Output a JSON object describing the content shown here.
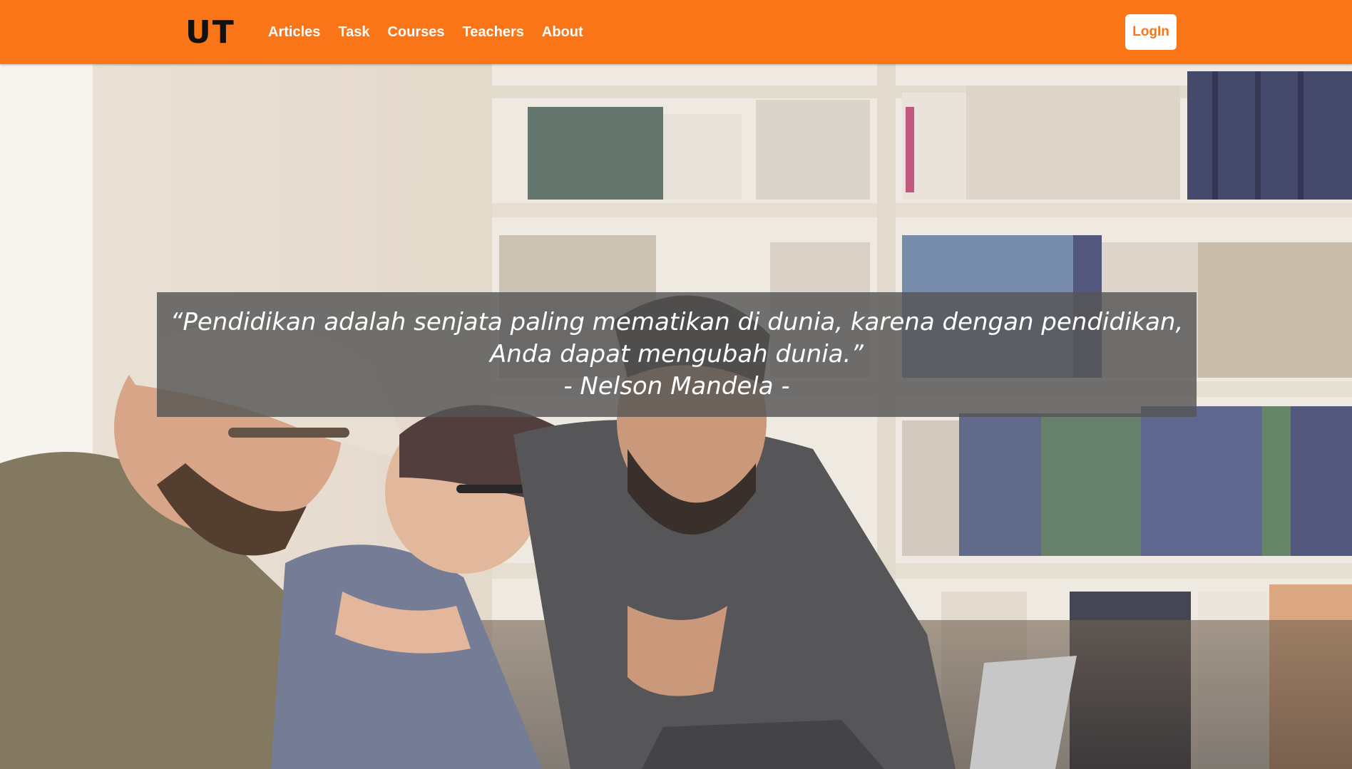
{
  "brand": {
    "logo_text": "UT"
  },
  "nav": {
    "links": [
      "Articles",
      "Task",
      "Courses",
      "Teachers",
      "About"
    ],
    "login_label": "LogIn"
  },
  "hero": {
    "quote_line1": "“Pendidikan adalah senjata paling mematikan di dunia, karena dengan pendidikan,",
    "quote_line2": "Anda dapat mengubah dunia.”",
    "author": "- Nelson Mandela -"
  },
  "colors": {
    "navbar": "#fa7518",
    "login_text": "#fa7518",
    "quote_bg": "rgba(85,85,85,0.82)"
  },
  "icons": {
    "hero_image": "students-laughing-library-photo"
  }
}
